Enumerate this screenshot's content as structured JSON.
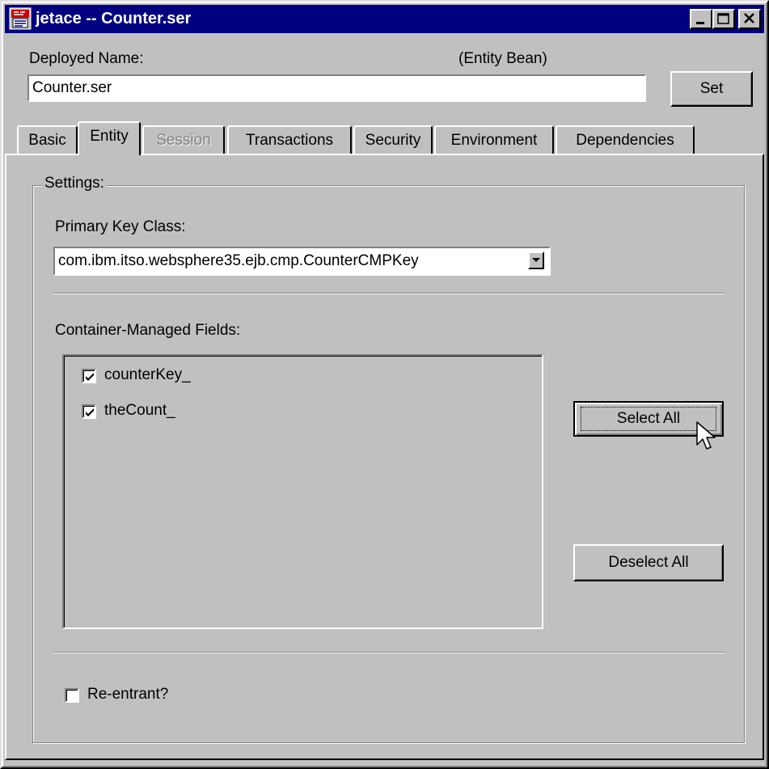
{
  "window": {
    "title": "jetace -- Counter.ser",
    "controls": [
      "minimize-icon",
      "maximize-icon",
      "close-icon"
    ]
  },
  "header": {
    "deployed_name_label": "Deployed Name:",
    "bean_type": "(Entity Bean)",
    "deployed_name_value": "Counter.ser",
    "set_button": "Set"
  },
  "tabs": [
    {
      "label": "Basic",
      "state": "normal"
    },
    {
      "label": "Entity",
      "state": "selected"
    },
    {
      "label": "Session",
      "state": "disabled"
    },
    {
      "label": "Transactions",
      "state": "normal"
    },
    {
      "label": "Security",
      "state": "normal"
    },
    {
      "label": "Environment",
      "state": "normal"
    },
    {
      "label": "Dependencies",
      "state": "normal"
    }
  ],
  "settings": {
    "group_label": "Settings:",
    "primary_key_label": "Primary Key Class:",
    "primary_key_value": "com.ibm.itso.websphere35.ejb.cmp.CounterCMPKey",
    "cmf_label": "Container-Managed Fields:",
    "fields": [
      {
        "label": "counterKey_",
        "checked": true
      },
      {
        "label": "theCount_",
        "checked": true
      }
    ],
    "select_all": "Select All",
    "deselect_all": "Deselect All",
    "reentrant_label": "Re-entrant?",
    "reentrant_checked": false
  },
  "colors": {
    "titlebar": "#000080",
    "face": "#c0c0c0",
    "disabled_text": "#808080"
  }
}
